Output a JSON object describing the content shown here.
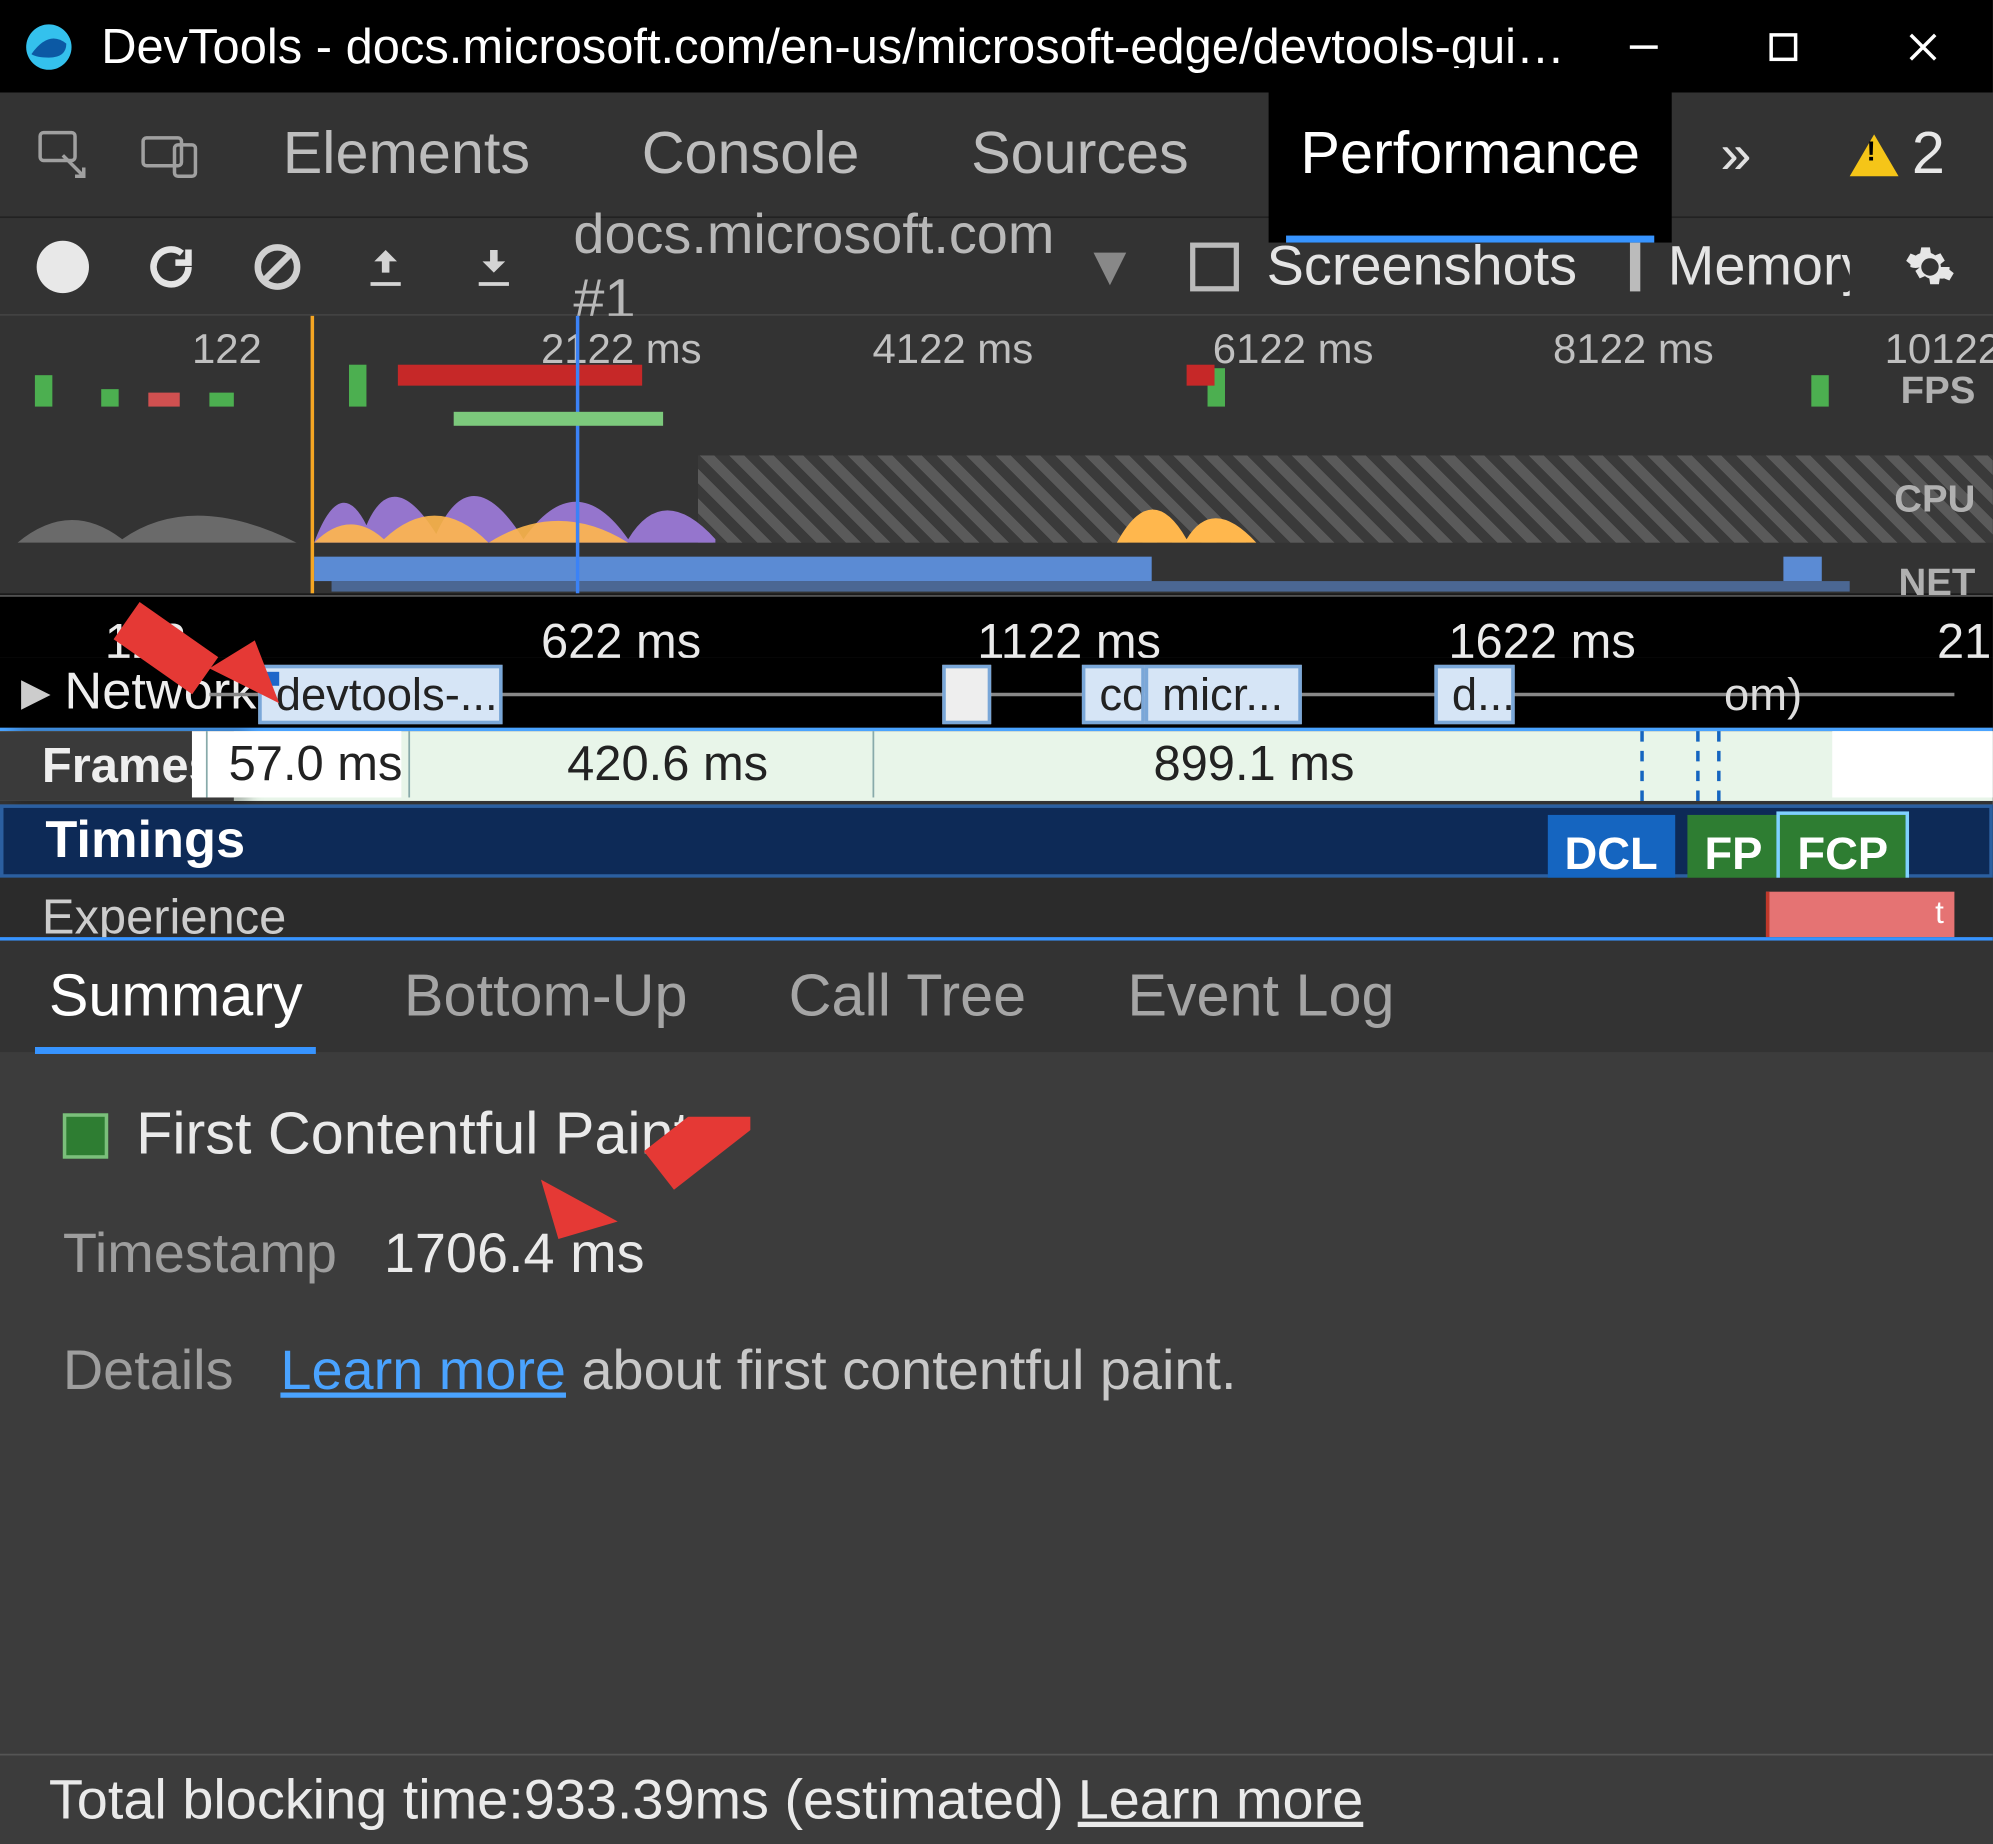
{
  "window": {
    "title": "DevTools - docs.microsoft.com/en-us/microsoft-edge/devtools-guide-chromium - [InPri..."
  },
  "tabs": {
    "items": [
      "Elements",
      "Console",
      "Sources",
      "Performance"
    ],
    "active": "Performance",
    "warning_count": "2"
  },
  "perf_toolbar": {
    "capture": "docs.microsoft.com #1",
    "screenshots_label": "Screenshots",
    "memory_label": "Memory"
  },
  "overview": {
    "ticks": [
      "122",
      "2122 ms",
      "4122 ms",
      "6122 ms",
      "8122 ms",
      "10122"
    ],
    "fps_label": "FPS",
    "cpu_label": "CPU",
    "net_label": "NET"
  },
  "flame_ruler": {
    "ticks": [
      "122",
      "622 ms",
      "1122 ms",
      "1622 ms",
      "21"
    ]
  },
  "network_track": {
    "label": "Network",
    "reqs": [
      {
        "label": "devtools-..."
      },
      {
        "label": "co"
      },
      {
        "label": "micr..."
      },
      {
        "label": "d..."
      },
      {
        "label": "om)"
      }
    ]
  },
  "frames_track": {
    "label": "Frames",
    "segments": [
      "57.0 ms",
      "420.6 ms",
      "899.1 ms"
    ]
  },
  "timings_track": {
    "label": "Timings",
    "badges": [
      {
        "text": "DCL",
        "color": "#1565c0"
      },
      {
        "text": "FP",
        "color": "#2e7d32"
      },
      {
        "text": "FCP",
        "color": "#2e7d32"
      }
    ]
  },
  "experience_track": {
    "label": "Experience",
    "badge": "t"
  },
  "bottom_tabs": {
    "items": [
      "Summary",
      "Bottom-Up",
      "Call Tree",
      "Event Log"
    ],
    "active": "Summary"
  },
  "summary": {
    "title": "First Contentful Paint",
    "timestamp_label": "Timestamp",
    "timestamp_value": "1706.4 ms",
    "details_label": "Details",
    "link_text": "Learn more",
    "details_tail": " about first contentful paint."
  },
  "footer": {
    "tbt_prefix": "Total blocking time: ",
    "tbt_value": "933.39ms (estimated)",
    "link": "Learn more"
  }
}
